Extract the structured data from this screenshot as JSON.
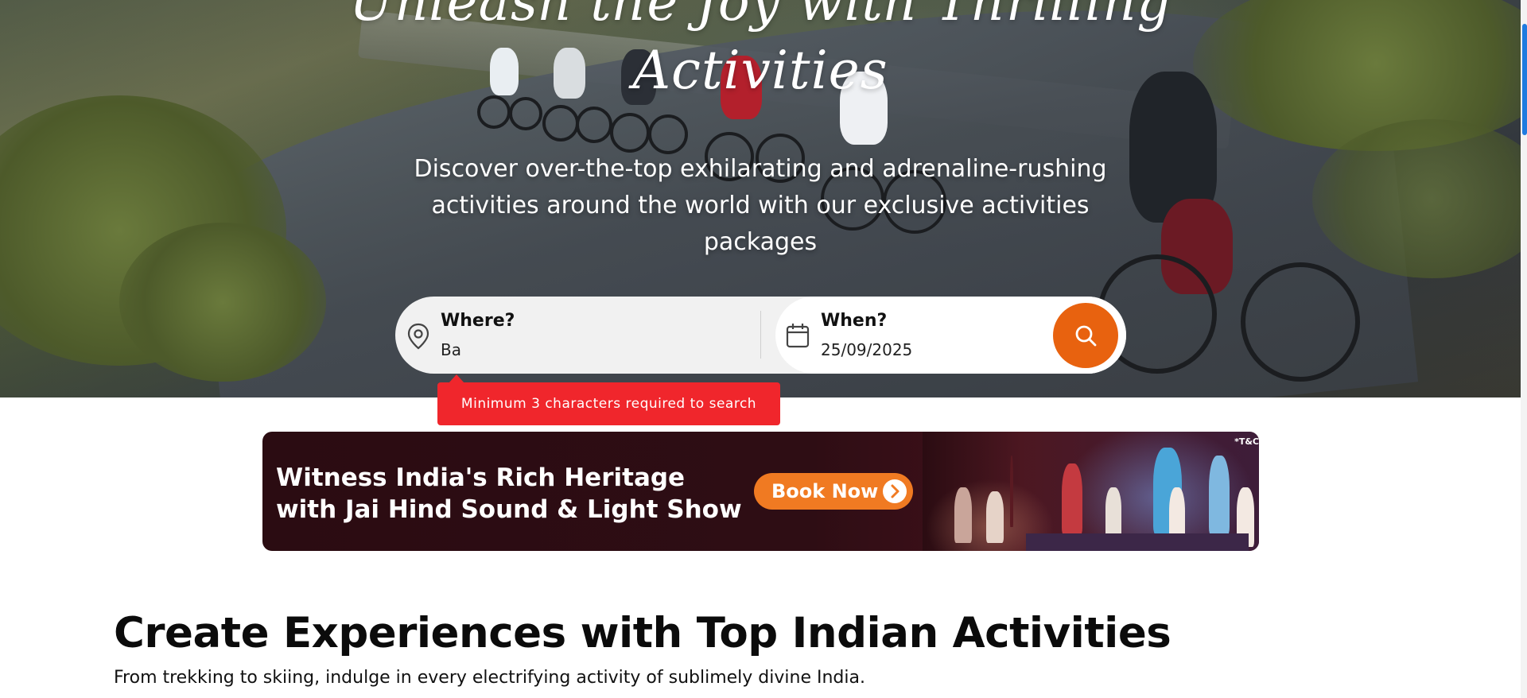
{
  "hero": {
    "title_line1": "Unleash the Joy with Thrilling",
    "title_line2": "Activities",
    "subtitle": "Discover over-the-top exhilarating and adrenaline-rushing activities around the world with our exclusive activities packages"
  },
  "search": {
    "where_label": "Where?",
    "where_value": "Ba",
    "when_label": "When?",
    "when_value": "25/09/2025",
    "error_message": "Minimum 3 characters required to search"
  },
  "banner": {
    "heading_line1": "Witness India's Rich Heritage",
    "heading_line2": "with Jai Hind Sound & Light Show",
    "button_label": "Book Now",
    "tc": "*T&C"
  },
  "section": {
    "title": "Create Experiences with Top Indian Activities",
    "subtitle": "From trekking to skiing, indulge in every electrifying activity of sublimely divine India."
  },
  "colors": {
    "accent": "#e8620f",
    "error": "#f0262c",
    "banner_bg": "#2b0c12",
    "scroll": "#1e7be0"
  },
  "icons": [
    "location-pin-icon",
    "calendar-icon",
    "search-icon",
    "arrow-right-icon"
  ]
}
